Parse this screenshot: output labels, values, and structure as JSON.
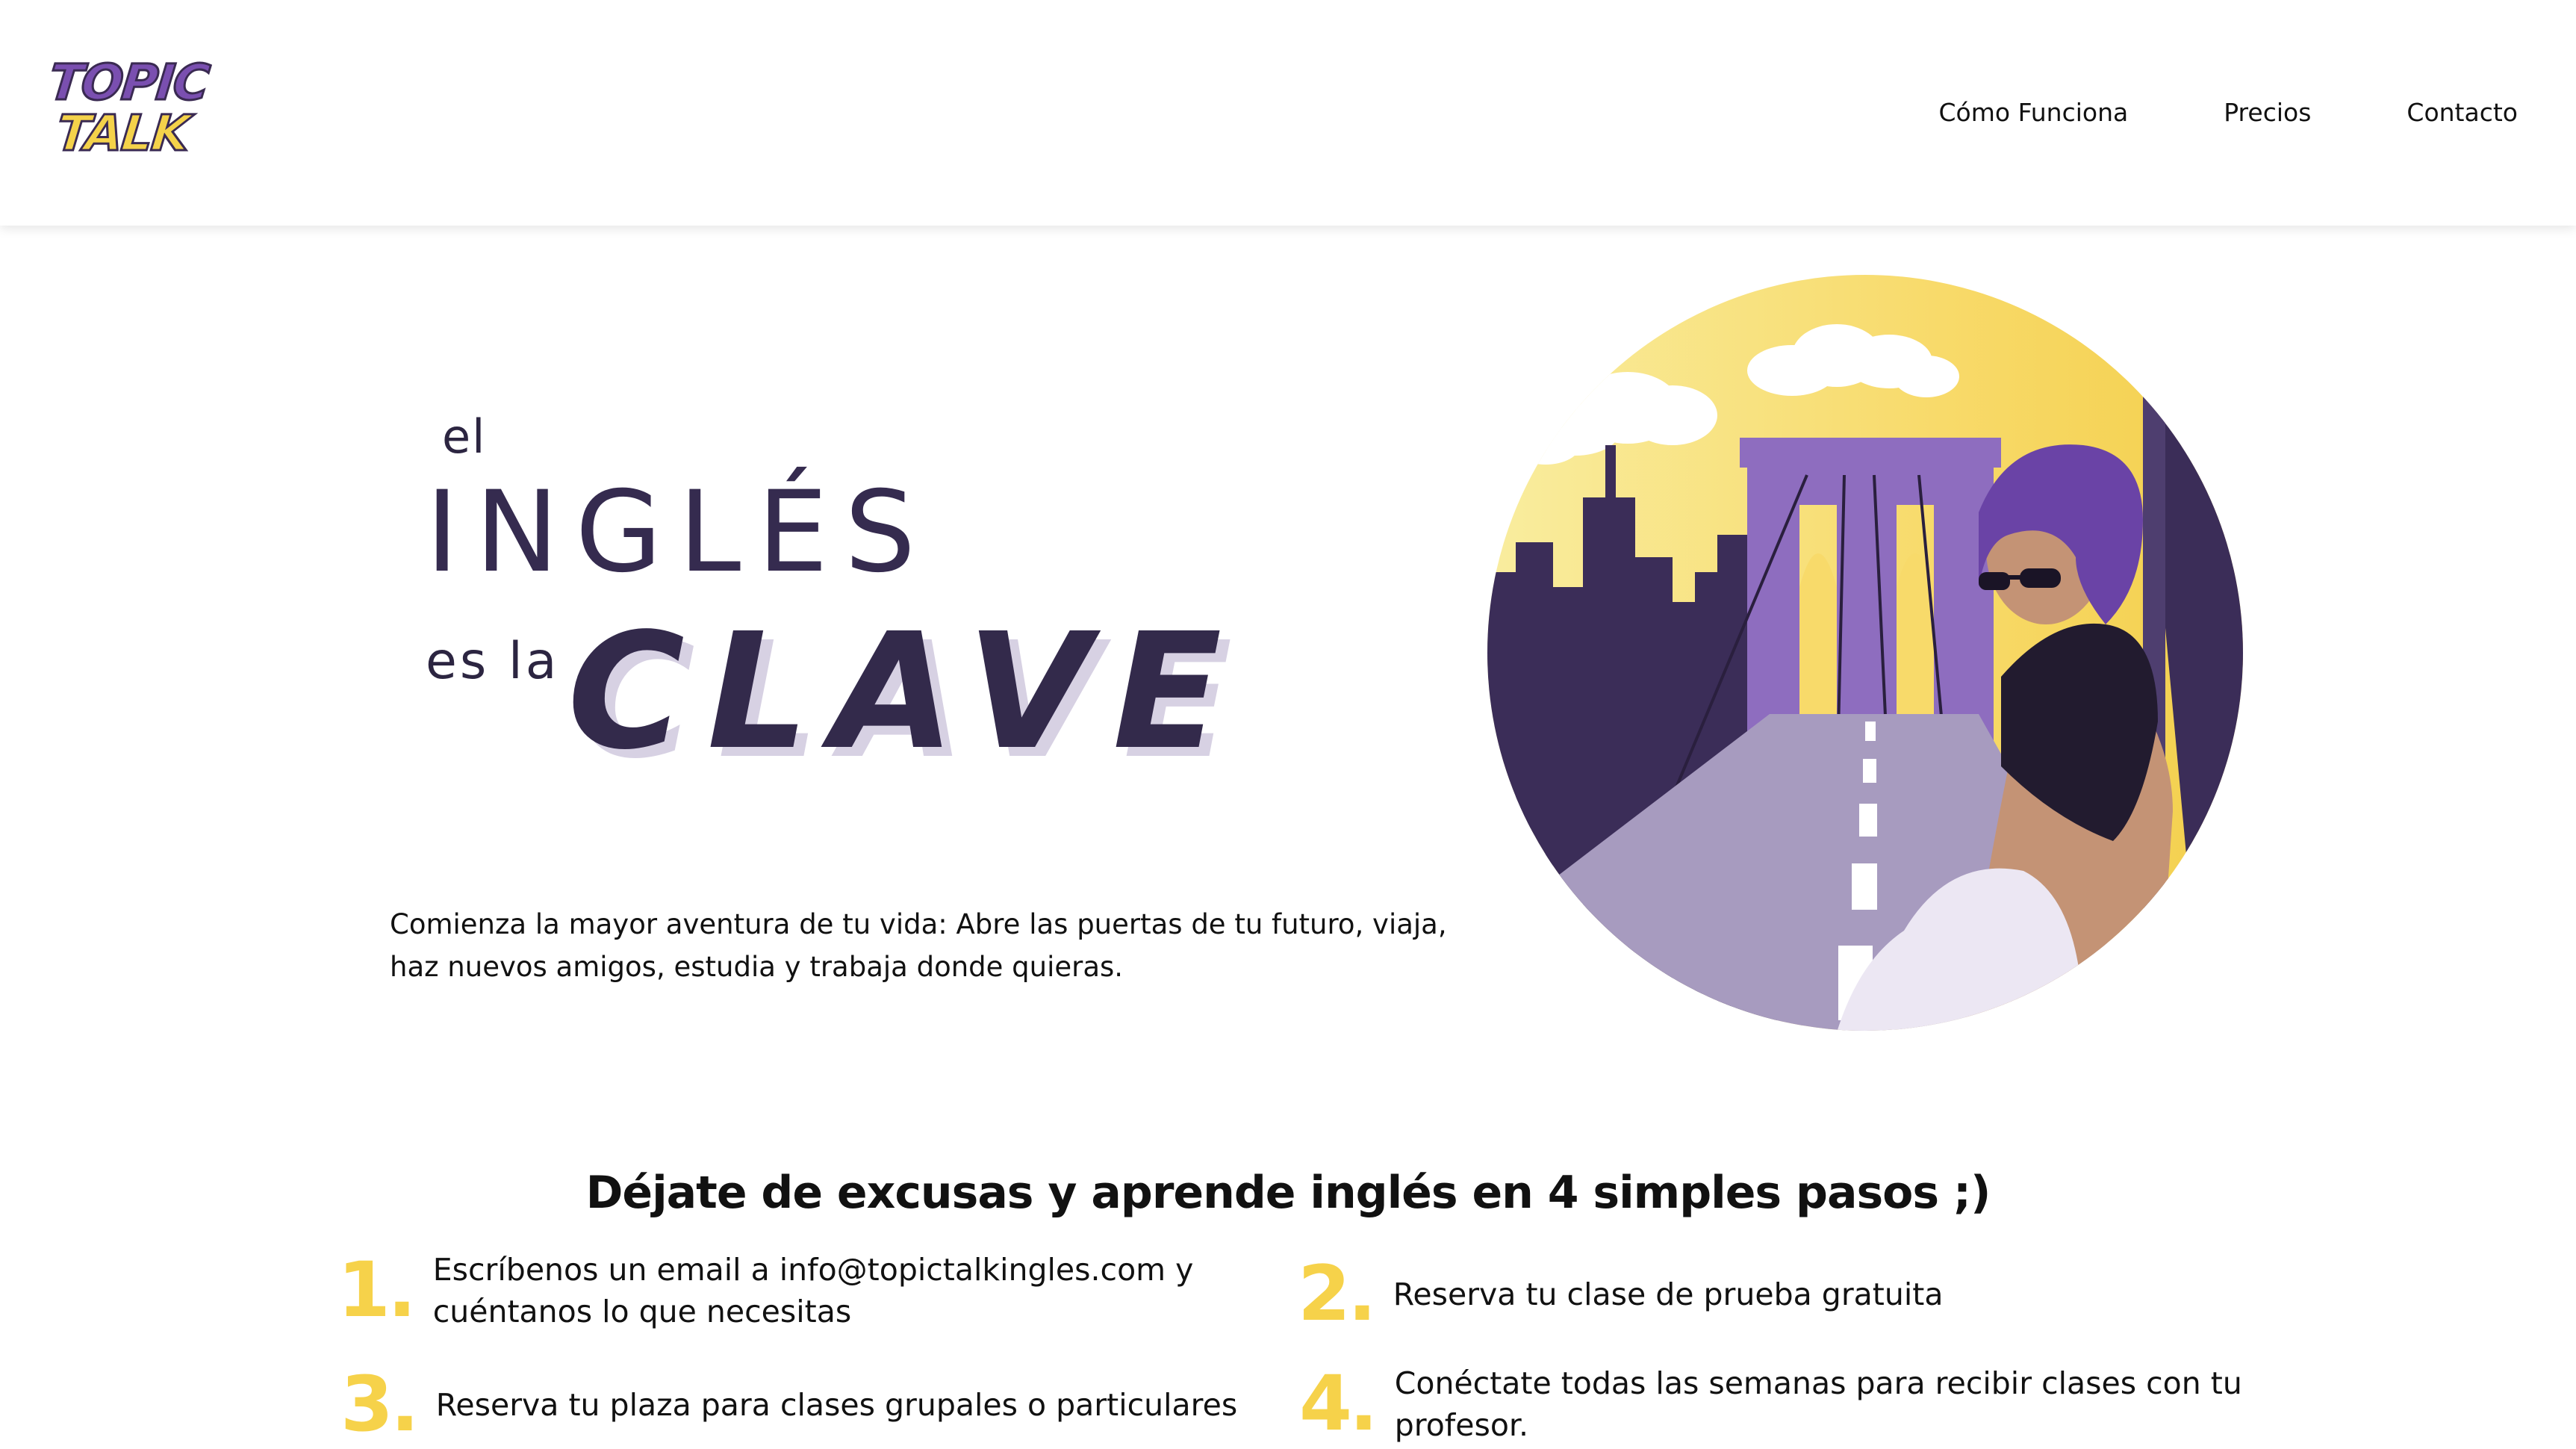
{
  "brand": {
    "logo_top": "TOPIC",
    "logo_bottom": "TALK"
  },
  "nav": {
    "items": [
      {
        "label": "Cómo Funciona"
      },
      {
        "label": "Precios"
      },
      {
        "label": "Contacto"
      }
    ]
  },
  "hero": {
    "word_el": "el",
    "word_ingles": "INGLÉS",
    "word_esla": "es la",
    "word_clave": "CLAVE",
    "description": "Comienza la mayor aventura de tu vida: Abre las puertas de tu futuro, viaja, haz nuevos amigos, estudia y trabaja donde quieras.",
    "illustration": "woman-bridge-illustration"
  },
  "steps": {
    "title": "Déjate de excusas y aprende inglés en 4 simples pasos ;)",
    "items": [
      {
        "number": "1.",
        "text": "Escríbenos un email a info@topictalkingles.com y cuéntanos lo que necesitas"
      },
      {
        "number": "2.",
        "text": "Reserva tu clase de prueba gratuita"
      },
      {
        "number": "3.",
        "text": "Reserva tu plaza para clases grupales o particulares"
      },
      {
        "number": "4.",
        "text": "Conéctate todas las semanas para recibir clases con tu profesor."
      }
    ]
  },
  "colors": {
    "accent_yellow": "#f6d24a",
    "brand_purple": "#7a4fb0",
    "dark_purple": "#352b4f"
  }
}
